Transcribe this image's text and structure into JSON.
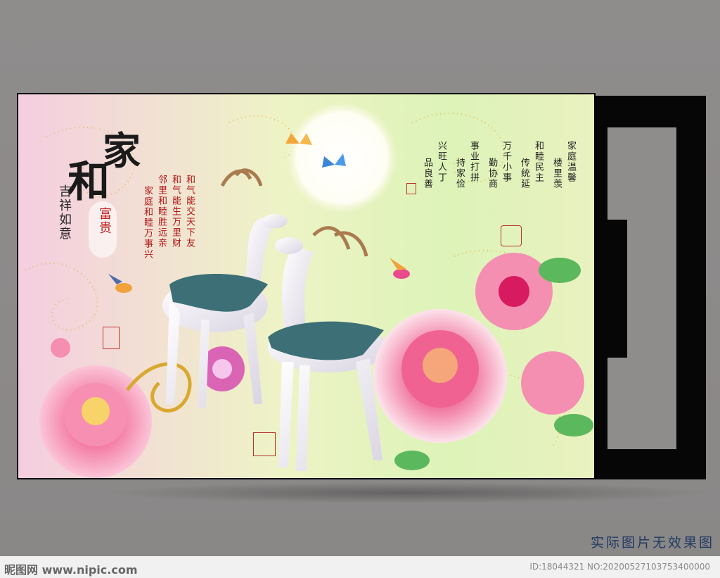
{
  "mural": {
    "title_chars": [
      "家",
      "和"
    ],
    "subtitle_vertical": "吉祥如意",
    "fuugui": "富贵",
    "left_poem_columns": [
      "和气能交天下友",
      "和气能生万里财",
      "邻里和睦胜远亲",
      "家庭和睦万事兴"
    ],
    "right_poem_columns": [
      "家庭温馨",
      "楼里羡",
      "和睦民主",
      "传统延",
      "万千小事",
      "勤协商",
      "事业打拼",
      "持家俭",
      "兴旺人丁",
      "品良善"
    ]
  },
  "caption": "实际图片无效果图",
  "footer": {
    "logo": "昵图网 www.nipic.com",
    "id": "ID:18044321 NO:20200527103753400000"
  },
  "colors": {
    "wall": "#8f8c8c",
    "caption": "#1f3a63",
    "peony": "#f06292",
    "deer": "#f2f0f5",
    "saddle": "#3d6f76"
  }
}
